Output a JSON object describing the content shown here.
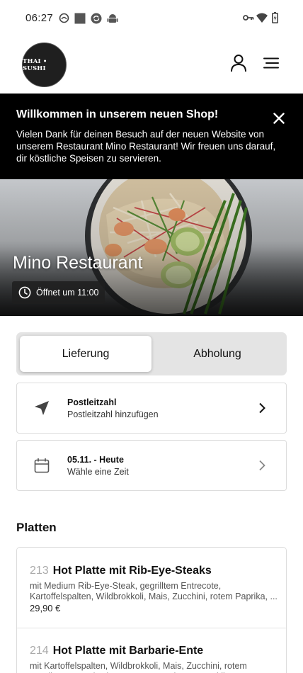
{
  "status_bar": {
    "time": "06:27",
    "left_icons": [
      "app-icon",
      "square-icon",
      "sync-icon",
      "android-icon"
    ],
    "right_icons": [
      "key-icon",
      "wifi-icon",
      "battery-icon"
    ]
  },
  "header": {
    "logo_text": "THAI • SUSHI",
    "icons": [
      "user-icon",
      "menu-icon"
    ]
  },
  "banner": {
    "title": "Willkommen in unserem neuen Shop!",
    "text": "Vielen Dank für deinen Besuch auf der neuen Website von unserem Restaurant Mino Restaurant! Wir freuen uns darauf, dir köstliche Speisen zu servieren.",
    "close_icon": "close-icon"
  },
  "hero": {
    "title": "Mino Restaurant",
    "opening": "Öffnet um 11:00"
  },
  "order_mode": {
    "options": [
      "Lieferung",
      "Abholung"
    ],
    "selected": "Lieferung"
  },
  "postcode_card": {
    "title": "Postleitzahl",
    "subtitle": "Postleitzahl hinzufügen"
  },
  "time_card": {
    "title": "05.11. - Heute",
    "subtitle": "Wähle eine Zeit"
  },
  "section": {
    "title": "Platten"
  },
  "menu_items": [
    {
      "number": "213",
      "name": "Hot Platte mit Rib-Eye-Steaks",
      "description": "mit Medium Rib-Eye-Steak, gegrilltem Entrecote, Kartoffelspalten, Wildbrokkoli, Mais, Zucchini, rotem Paprika, ...",
      "price": "29,90 €"
    },
    {
      "number": "214",
      "name": "Hot Platte mit Barbarie-Ente",
      "description": "mit Kartoffelspalten, Wildbrokkoli, Mais, Zucchini, rotem Paprika, Spargel, Cherrytomaten und Kräuterseitlingen",
      "price": ""
    }
  ],
  "colors": {
    "banner_bg": "#000000",
    "toggle_bg": "#e4e4e4",
    "card_border": "#dcdcdc",
    "muted_number": "#aaaaaa"
  }
}
